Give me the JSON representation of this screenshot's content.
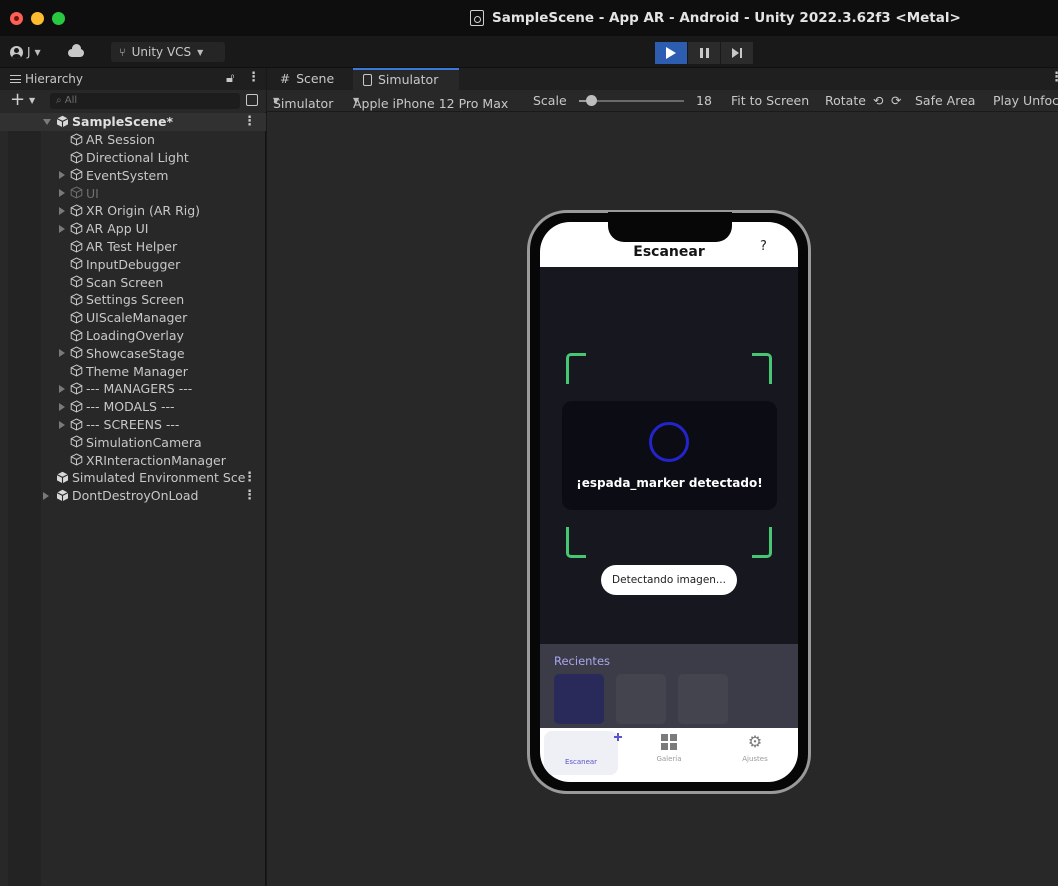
{
  "window": {
    "title": "SampleScene - App AR - Android - Unity 2022.3.62f3 <Metal>"
  },
  "toolbar": {
    "account_label": "J",
    "vcs_label": "Unity VCS"
  },
  "hierarchy": {
    "tab_label": "Hierarchy",
    "search_placeholder": "All",
    "scene_name": "SampleScene*",
    "items": [
      {
        "label": "AR Session"
      },
      {
        "label": "Directional Light"
      },
      {
        "label": "EventSystem"
      },
      {
        "label": "UI"
      },
      {
        "label": "XR Origin (AR Rig)"
      },
      {
        "label": "AR App UI"
      },
      {
        "label": "AR Test Helper"
      },
      {
        "label": "InputDebugger"
      },
      {
        "label": "Scan Screen"
      },
      {
        "label": "Settings Screen"
      },
      {
        "label": "UIScaleManager"
      },
      {
        "label": "LoadingOverlay"
      },
      {
        "label": "ShowcaseStage"
      },
      {
        "label": "Theme Manager"
      },
      {
        "label": "--- MANAGERS ---"
      },
      {
        "label": "--- MODALS ---"
      },
      {
        "label": "--- SCREENS ---"
      },
      {
        "label": "SimulationCamera"
      },
      {
        "label": "XRInteractionManager"
      }
    ],
    "simulated_env": "Simulated Environment Sce",
    "dont_destroy": "DontDestroyOnLoad"
  },
  "tabs": {
    "scene": "Scene",
    "simulator": "Simulator"
  },
  "sim_toolbar": {
    "mode": "Simulator",
    "device": "Apple iPhone 12 Pro Max",
    "scale_label": "Scale",
    "scale_value": "18",
    "fit": "Fit to Screen",
    "rotate": "Rotate",
    "safe_area": "Safe Area",
    "play_unfocused": "Play Unfoc"
  },
  "app": {
    "title": "Escanear",
    "help": "?",
    "detected_text": "¡espada_marker detectado!",
    "status_pill": "Detectando imagen...",
    "recent_title": "Recientes",
    "nav": {
      "scan": "Escanear",
      "gallery": "Galería",
      "settings": "Ajustes"
    },
    "colors": {
      "accent": "#5a55cc",
      "frame_green": "#45c774",
      "spinner_blue": "#2424cc"
    }
  }
}
